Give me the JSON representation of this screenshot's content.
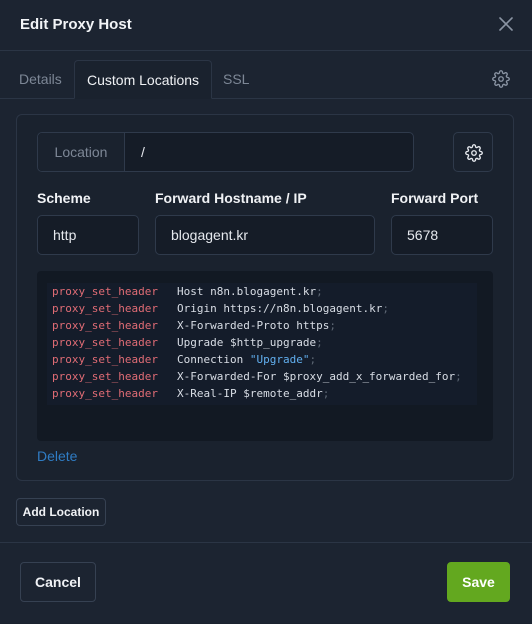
{
  "modal": {
    "title": "Edit Proxy Host"
  },
  "tabs": [
    {
      "label": "Details",
      "active": false
    },
    {
      "label": "Custom Locations",
      "active": true
    },
    {
      "label": "SSL",
      "active": false
    }
  ],
  "location": {
    "prefix": "Location",
    "value": "/",
    "scheme_label": "Scheme",
    "scheme_value": "http",
    "hostname_label": "Forward Hostname / IP",
    "hostname_value": "blogagent.kr",
    "port_label": "Forward Port",
    "port_value": "5678",
    "config_lines": [
      {
        "directive": "proxy_set_header",
        "name": "Host",
        "value": "n8n.blogagent.kr",
        "quoted": false
      },
      {
        "directive": "proxy_set_header",
        "name": "Origin",
        "value": "https://n8n.blogagent.kr",
        "quoted": false
      },
      {
        "directive": "proxy_set_header",
        "name": "X-Forwarded-Proto",
        "value": "https",
        "quoted": false
      },
      {
        "directive": "proxy_set_header",
        "name": "Upgrade",
        "value": "$http_upgrade",
        "quoted": false
      },
      {
        "directive": "proxy_set_header",
        "name": "Connection",
        "value": "\"Upgrade\"",
        "quoted": true
      },
      {
        "directive": "proxy_set_header",
        "name": "X-Forwarded-For",
        "value": "$proxy_add_x_forwarded_for",
        "quoted": false
      },
      {
        "directive": "proxy_set_header",
        "name": "X-Real-IP",
        "value": "$remote_addr",
        "quoted": false
      }
    ],
    "delete_label": "Delete"
  },
  "actions": {
    "add_location": "Add Location",
    "cancel": "Cancel",
    "save": "Save"
  },
  "icons": {
    "close": "close-icon",
    "tab_settings": "gear-icon",
    "location_settings": "gear-icon"
  },
  "colors": {
    "accent_save": "#63a81f",
    "link": "#2f7cc4",
    "directive": "#e06c75",
    "string": "#61afef"
  }
}
